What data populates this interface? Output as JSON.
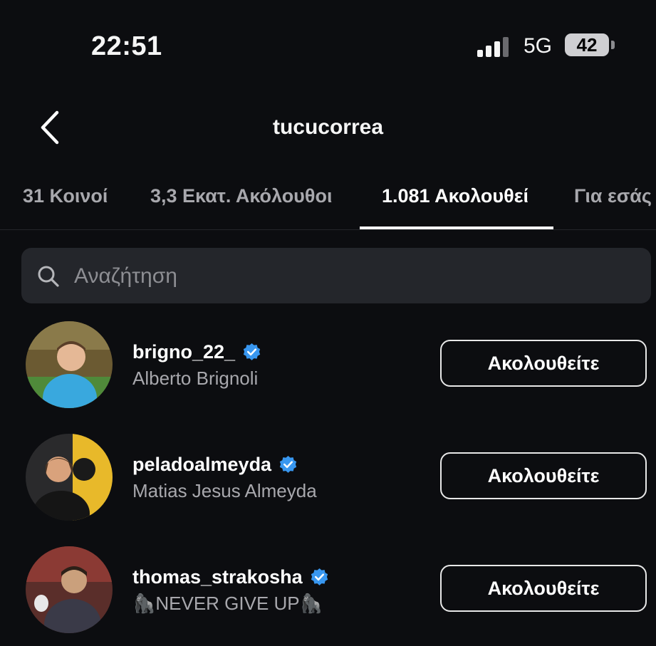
{
  "status_bar": {
    "time": "22:51",
    "network": "5G",
    "battery": "42"
  },
  "header": {
    "title": "tucucorrea",
    "back_icon": "chevron-left-icon"
  },
  "tabs": [
    {
      "label": "31 Κοινοί",
      "active": false
    },
    {
      "label": "3,3 Εκατ. Ακόλουθοι",
      "active": false
    },
    {
      "label": "1.081 Ακολουθεί",
      "active": true
    },
    {
      "label": "Για εσάς",
      "active": false
    }
  ],
  "search": {
    "placeholder": "Αναζήτηση",
    "value": ""
  },
  "users": [
    {
      "username": "brigno_22_",
      "full_name": "Alberto Brignoli",
      "verified": true,
      "button": "Ακολουθείτε"
    },
    {
      "username": "peladoalmeyda",
      "full_name": "Matias Jesus Almeyda",
      "verified": true,
      "button": "Ακολουθείτε"
    },
    {
      "username": "thomas_strakosha",
      "full_name": "🦍NEVER GIVE UP🦍",
      "verified": true,
      "button": "Ακολουθείτε"
    }
  ],
  "colors": {
    "background": "#0c0d10",
    "verified_badge": "#3897f0",
    "search_bg": "#24262b"
  }
}
